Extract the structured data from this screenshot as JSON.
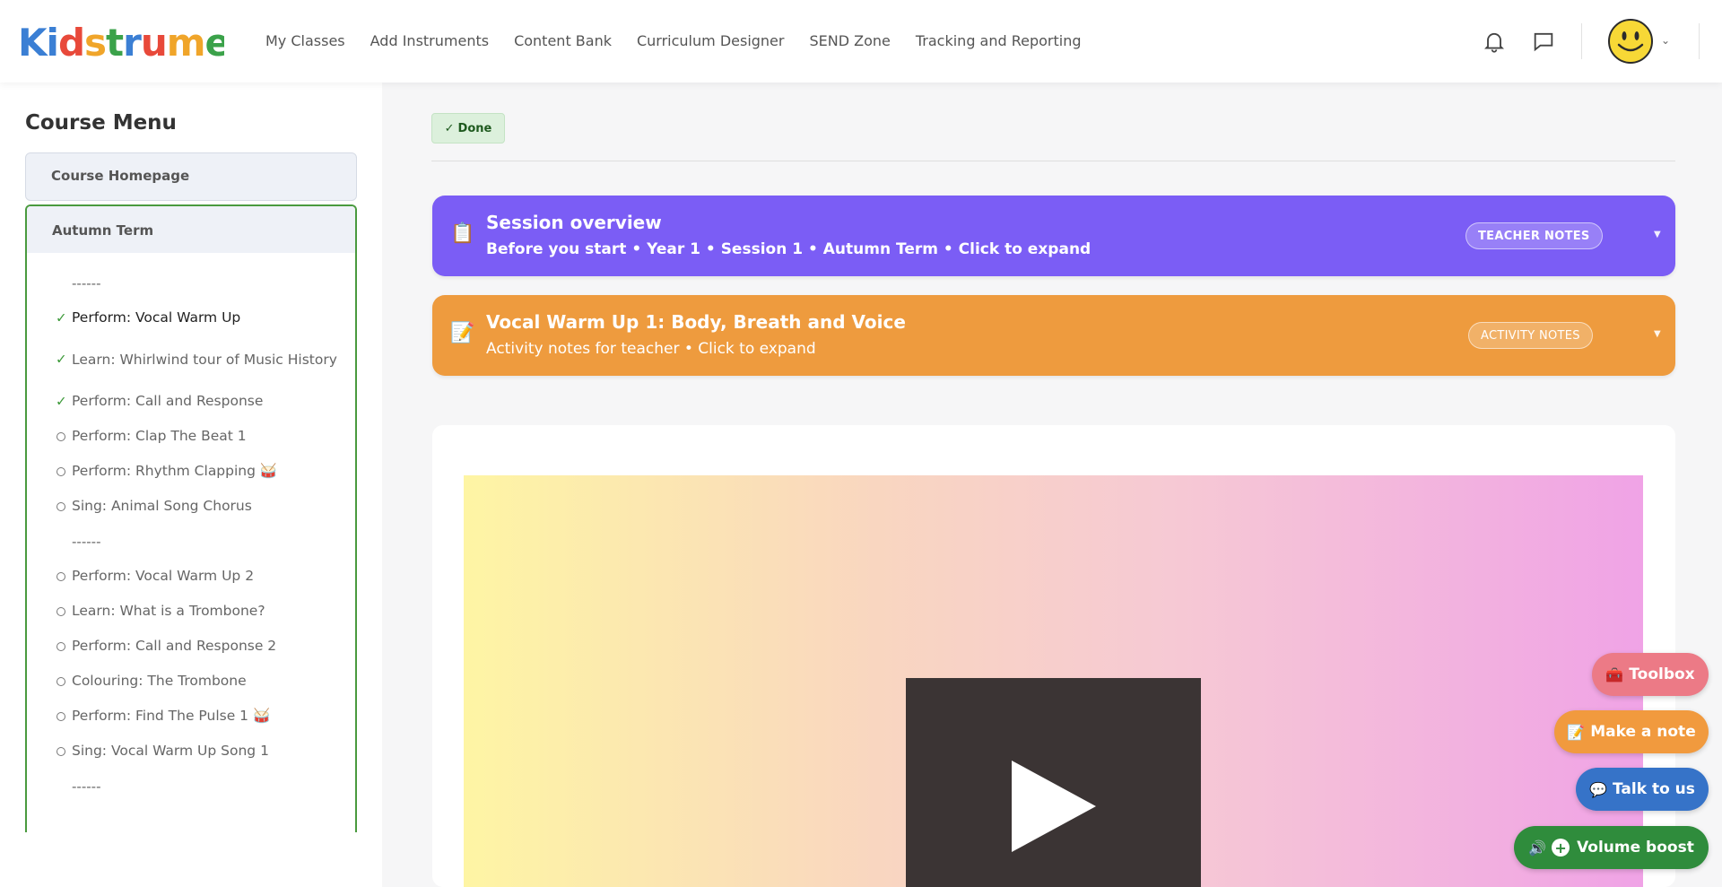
{
  "header": {
    "logo_text": "Kidstrument",
    "nav": [
      "My Classes",
      "Add Instruments",
      "Content Bank",
      "Curriculum Designer",
      "SEND Zone",
      "Tracking and Reporting"
    ]
  },
  "sidebar": {
    "title": "Course Menu",
    "home_label": "Course Homepage",
    "term_label": "Autumn Term",
    "items": [
      {
        "type": "sep",
        "label": "------"
      },
      {
        "type": "lesson",
        "status": "done",
        "label": "Perform: Vocal Warm Up",
        "active": true
      },
      {
        "type": "lesson",
        "status": "done",
        "label": "Learn: Whirlwind tour of Music History"
      },
      {
        "type": "lesson",
        "status": "done",
        "label": "Perform: Call and Response"
      },
      {
        "type": "lesson",
        "status": "todo",
        "label": "Perform: Clap The Beat 1"
      },
      {
        "type": "lesson",
        "status": "todo",
        "label": "Perform: Rhythm Clapping 🥁"
      },
      {
        "type": "lesson",
        "status": "todo",
        "label": "Sing: Animal Song Chorus"
      },
      {
        "type": "sep",
        "label": "------"
      },
      {
        "type": "lesson",
        "status": "todo",
        "label": "Perform: Vocal Warm Up 2"
      },
      {
        "type": "lesson",
        "status": "todo",
        "label": "Learn: What is a Trombone?"
      },
      {
        "type": "lesson",
        "status": "todo",
        "label": "Perform: Call and Response 2"
      },
      {
        "type": "lesson",
        "status": "todo",
        "label": "Colouring: The Trombone"
      },
      {
        "type": "lesson",
        "status": "todo",
        "label": "Perform: Find The Pulse 1 🥁"
      },
      {
        "type": "lesson",
        "status": "todo",
        "label": "Sing: Vocal Warm Up Song 1"
      },
      {
        "type": "sep",
        "label": "------"
      }
    ]
  },
  "main": {
    "done_label": "Done",
    "done_check": "✓",
    "banners": [
      {
        "emoji": "📋",
        "title": "Session overview",
        "subtitle": "Before you start • Year 1 • Session 1 • Autumn Term • Click to expand",
        "pill": "TEACHER NOTES",
        "chevron": "▼"
      },
      {
        "emoji": "📝",
        "title": "Vocal Warm Up 1: Body, Breath and Voice",
        "subtitle": "Activity notes for teacher • Click to expand",
        "pill": "ACTIVITY NOTES",
        "chevron": "▼"
      }
    ]
  },
  "fabs": {
    "toolbox": {
      "icon": "🧰",
      "label": "Toolbox"
    },
    "note": {
      "icon": "📝",
      "label": "Make a note"
    },
    "talk": {
      "icon": "💬",
      "label": "Talk to us"
    },
    "volume": {
      "icon": "🔊",
      "plus": "+",
      "label": "Volume boost"
    }
  },
  "colors": {
    "purple_banner": "#7b5df5",
    "orange_banner": "#ee9b3e",
    "active_border": "#4a9a3f",
    "done_green": "#3d9a3a"
  }
}
